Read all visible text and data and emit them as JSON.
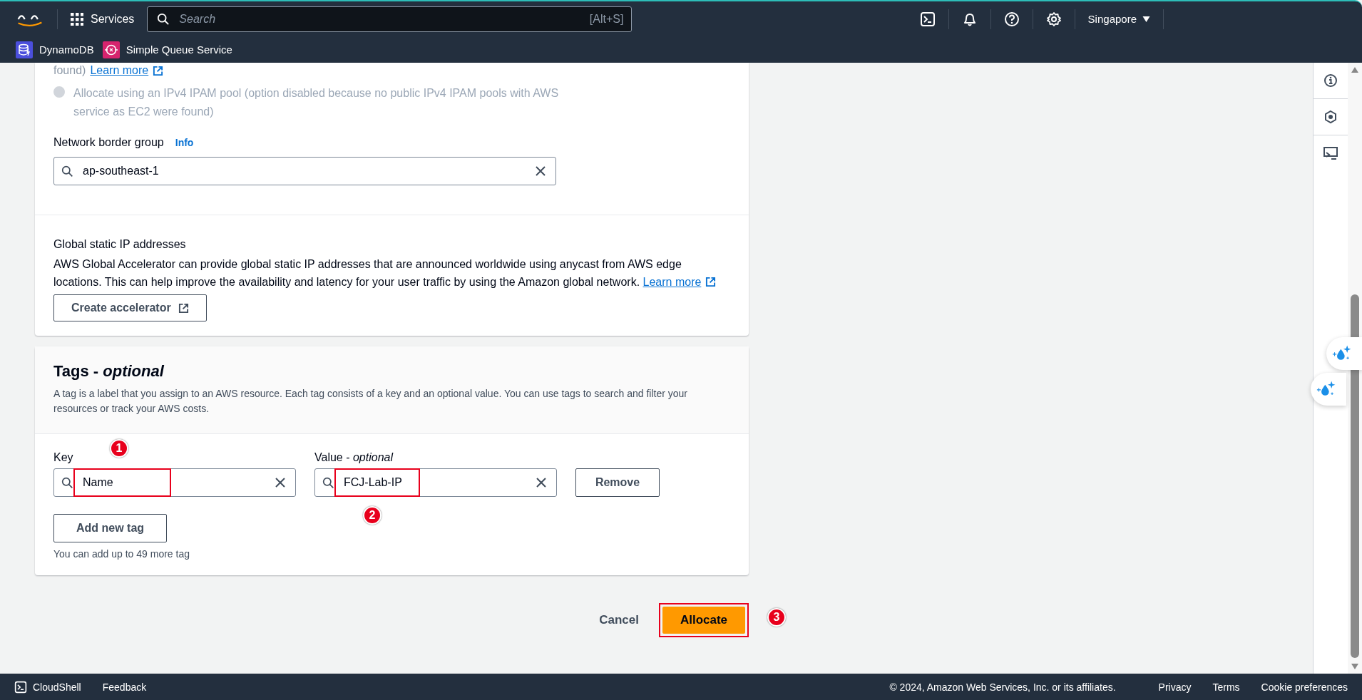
{
  "header": {
    "services": "Services",
    "search_placeholder": "Search",
    "search_shortcut": "[Alt+S]",
    "region": "Singapore"
  },
  "favorites": [
    {
      "label": "DynamoDB"
    },
    {
      "label": "Simple Queue Service"
    }
  ],
  "previous_option": {
    "tail": "found)",
    "link": "Learn more"
  },
  "ipam_option": {
    "label": "Allocate using an IPv4 IPAM pool (option disabled because no public IPv4 IPAM pools with AWS service as EC2 were found)",
    "disabled": true,
    "selected": false
  },
  "network_border_group": {
    "label": "Network border group",
    "info": "Info",
    "value": "ap-southeast-1"
  },
  "global_static_ip": {
    "title": "Global static IP addresses",
    "description": "AWS Global Accelerator can provide global static IP addresses that are announced worldwide using anycast from AWS edge locations. This can help improve the availability and latency for your user traffic by using the Amazon global",
    "last_word": "network.",
    "link": "Learn more",
    "button": "Create accelerator"
  },
  "tags": {
    "title": "Tags - *optional*",
    "description": "A tag is a label that you assign to an AWS resource. Each tag consists of a key and an optional value. You can use tags to search and filter your resources or track your AWS costs.",
    "key_label": "Key",
    "value_label": "Value - *optional*",
    "rows": [
      {
        "key": "Name",
        "value": "FCJ-Lab-IP",
        "key_highlighted": true,
        "value_highlighted": true,
        "key_marker": "1",
        "value_marker": "2",
        "remove": "Remove"
      }
    ],
    "add": "Add new tag",
    "hint": "You can add up to 49 more tag"
  },
  "actions": {
    "cancel": "Cancel",
    "submit": "Allocate",
    "submit_highlighted": true,
    "submit_marker": "3"
  },
  "footer": {
    "cloudshell": "CloudShell",
    "feedback": "Feedback",
    "copyright": "© 2024, Amazon Web Services, Inc. or its affiliates.",
    "links": [
      "Privacy",
      "Terms",
      "Cookie preferences"
    ]
  }
}
